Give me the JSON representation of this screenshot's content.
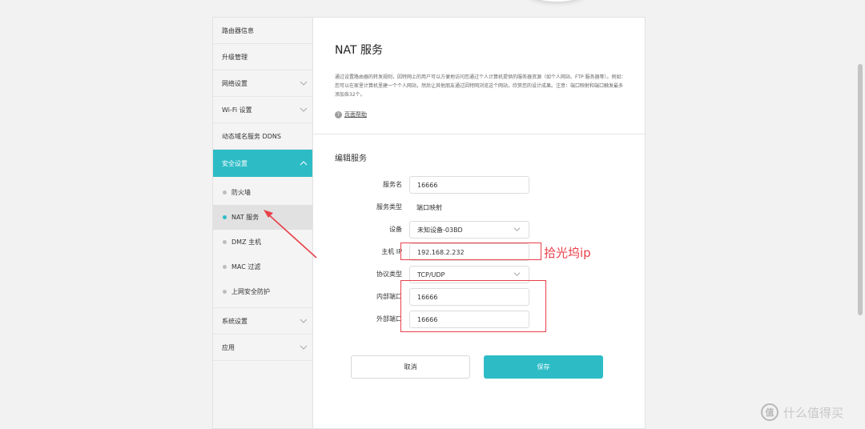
{
  "sidebar": {
    "items": [
      {
        "label": "路由器信息",
        "chevron": false
      },
      {
        "label": "升级管理",
        "chevron": false
      },
      {
        "label": "网络设置",
        "chevron": true
      },
      {
        "label": "Wi-Fi 设置",
        "chevron": true
      },
      {
        "label": "动态域名服务 DDNS",
        "chevron": false
      }
    ],
    "active_group": {
      "label": "安全设置"
    },
    "sub_items": [
      {
        "label": "防火墙"
      },
      {
        "label": "NAT 服务",
        "selected": true
      },
      {
        "label": "DMZ 主机"
      },
      {
        "label": "MAC 过滤"
      },
      {
        "label": "上网安全防护"
      }
    ],
    "bottom_items": [
      {
        "label": "系统设置",
        "chevron": true
      },
      {
        "label": "应用",
        "chevron": true
      }
    ]
  },
  "content": {
    "title": "NAT 服务",
    "description": "通过设置路由器的转发规则，因特网上的用户可以方便地访问您通过个人计算机提供的服务器资源（如个人网站、FTP 服务器等）。例如：您可以在家里计算机里建一个个人网站，然后让其他朋友通过因特网浏览这个网站，欣赏您的设计成果。注意：端口映射和端口触发最多添加各32个。",
    "help_link": "页面帮助",
    "section_title": "编辑服务",
    "form": {
      "service_name_label": "服务名",
      "service_name_value": "16666",
      "service_type_label": "服务类型",
      "service_type_value": "端口映射",
      "device_label": "设备",
      "device_value": "未知设备-03BD",
      "host_ip_label": "主机 IP",
      "host_ip_value": "192.168.2.232",
      "protocol_label": "协议类型",
      "protocol_value": "TCP/UDP",
      "internal_port_label": "内部端口",
      "internal_port_value": "16666",
      "external_port_label": "外部端口",
      "external_port_value": "16666"
    },
    "buttons": {
      "cancel": "取消",
      "save": "保存"
    }
  },
  "annotation": {
    "label": "拾光坞ip",
    "color": "#e8404a"
  },
  "watermark": {
    "badge": "值",
    "text": "什么值得买"
  },
  "colors": {
    "accent": "#2dbcc6",
    "annotation": "#e8404a"
  }
}
